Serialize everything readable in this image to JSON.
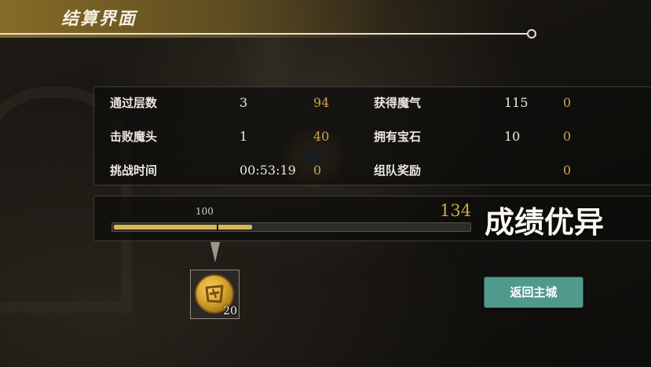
{
  "header": {
    "title": "结算界面"
  },
  "stats": {
    "left": [
      {
        "label": "通过层数",
        "value": "3",
        "score": "94"
      },
      {
        "label": "击败魔头",
        "value": "1",
        "score": "40"
      },
      {
        "label": "挑战时间",
        "value": "00:53:19",
        "score": "0"
      }
    ],
    "right": [
      {
        "label": "获得魔气",
        "value": "115",
        "score": "0"
      },
      {
        "label": "拥有宝石",
        "value": "10",
        "score": "0"
      },
      {
        "label": "组队奖励",
        "value": "",
        "score": "0"
      }
    ]
  },
  "progress": {
    "threshold_label": "100",
    "total": "134",
    "fill_fraction": 0.39,
    "threshold_fraction": 0.29,
    "fill_color": "#d9b653"
  },
  "grade": {
    "text": "成绩优异"
  },
  "reward": {
    "icon": "gold-coin-icon",
    "count": "20"
  },
  "actions": {
    "return_label": "返回主城",
    "button_color": "#4f9a8c"
  }
}
